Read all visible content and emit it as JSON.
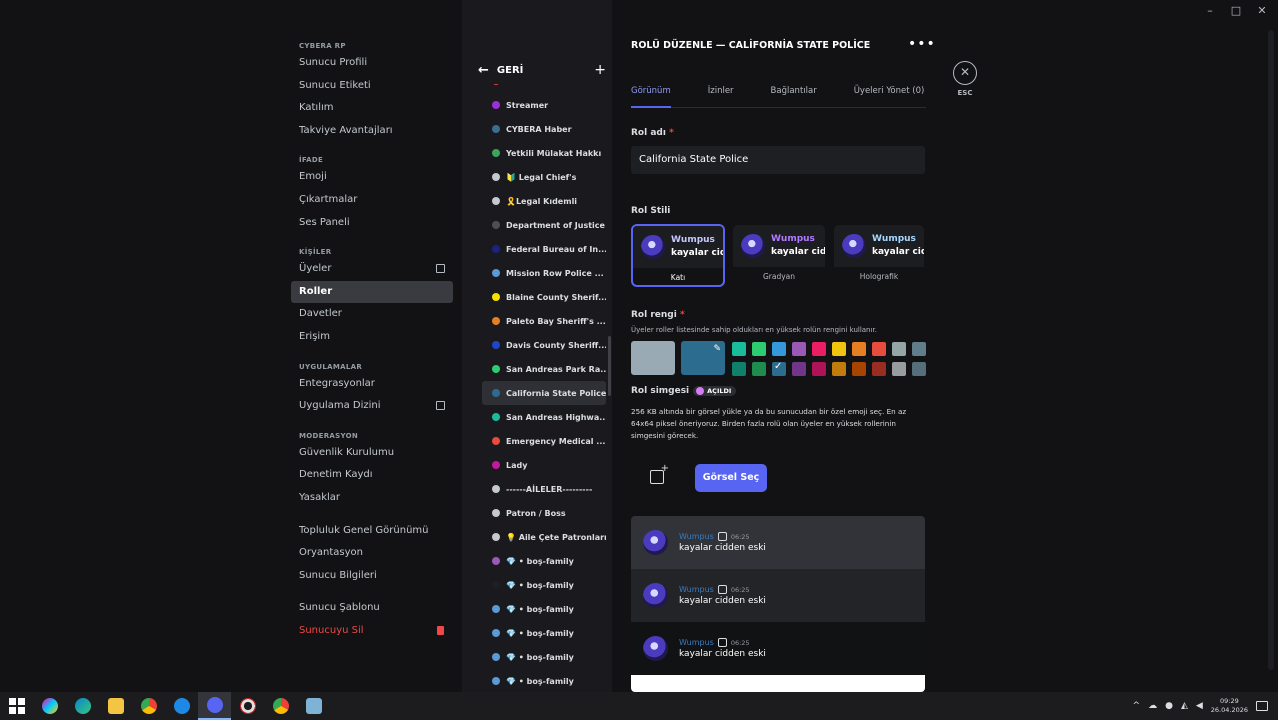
{
  "window": {
    "minimize": "–",
    "maximize": "□",
    "close": "✕"
  },
  "leftnav": {
    "sections": [
      {
        "title": "CYBERA RP",
        "items": [
          "Sunucu Profili",
          "Sunucu Etiketi",
          "Katılım",
          "Takviye Avantajları"
        ]
      },
      {
        "title": "İFADE",
        "items": [
          "Emoji",
          "Çıkartmalar",
          "Ses Paneli"
        ]
      },
      {
        "title": "KİŞİLER",
        "items": [
          "Üyeler",
          "Roller",
          "Davetler",
          "Erişim"
        ]
      },
      {
        "title": "UYGULAMALAR",
        "items": [
          "Entegrasyonlar",
          "Uygulama Dizini"
        ]
      },
      {
        "title": "MODERASYON",
        "items": [
          "Güvenlik Kurulumu",
          "Denetim Kaydı",
          "Yasaklar"
        ]
      }
    ],
    "extra_items": [
      "Topluluk Genel Görünümü",
      "Oryantasyon",
      "Sunucu Bilgileri"
    ],
    "template_item": "Sunucu Şablonu",
    "delete_item": "Sunucuyu Sil",
    "active_item": "Roller"
  },
  "roles_panel": {
    "back_label": "GERİ",
    "add_symbol": "+",
    "partial_role": "♡ Koramal Stali",
    "roles": [
      {
        "name": "Streamer",
        "color": "#9b30d9"
      },
      {
        "name": "CYBERA Haber",
        "color": "#3b6e8f"
      },
      {
        "name": "Yetkili Mülakat Hakkı",
        "color": "#3ba55c"
      },
      {
        "name": "🔰 Legal Chief's",
        "color": "#c4c9ce"
      },
      {
        "name": "🎗️Legal Kıdemli",
        "color": "#c4c9ce"
      },
      {
        "name": "Department of Justice",
        "color": "#4e4e55"
      },
      {
        "name": "Federal Bureau of In...",
        "color": "#1a237e"
      },
      {
        "name": "Mission Row Police ...",
        "color": "#5b9bd5"
      },
      {
        "name": "Blaine County Sherif...",
        "color": "#f5e000"
      },
      {
        "name": "Paleto Bay Sheriff's ...",
        "color": "#e67e22"
      },
      {
        "name": "Davis County Sheriff...",
        "color": "#1f45c9"
      },
      {
        "name": "San Andreas Park Ra...",
        "color": "#2ecc71"
      },
      {
        "name": "California State Police",
        "color": "#2c6d8f"
      },
      {
        "name": "San Andreas Highwa...",
        "color": "#1abc9c"
      },
      {
        "name": "Emergency Medical ...",
        "color": "#e74c3c"
      },
      {
        "name": "Lady",
        "color": "#c2189e"
      },
      {
        "name": "------AİLELER---------",
        "color": "#c4c9ce"
      },
      {
        "name": "Patron / Boss",
        "color": "#c4c9ce"
      },
      {
        "name": "💡 Aile Çete Patronları",
        "color": "#c4c9ce"
      },
      {
        "name": "💎 • boş-family",
        "color": "#9b59b6"
      },
      {
        "name": "💎 • boş-family",
        "color": "#1e1f22"
      },
      {
        "name": "💎 • boş-family",
        "color": "#5b9bd5"
      },
      {
        "name": "💎 • boş-family",
        "color": "#5b9bd5"
      },
      {
        "name": "💎 • boş-family",
        "color": "#5b9bd5"
      },
      {
        "name": "💎 • boş-family",
        "color": "#5b9bd5"
      }
    ],
    "active_role": "California State Police"
  },
  "editor": {
    "title": "ROLÜ DÜZENLE — CALİFORNİA STATE POLİCE",
    "more": "•••",
    "tabs": [
      "Görünüm",
      "İzinler",
      "Bağlantılar",
      "Üyeleri Yönet (0)"
    ],
    "active_tab": "Görünüm",
    "role_name_label": "Rol adı",
    "required_mark": "*",
    "role_name_value": "California  State Police",
    "style_label": "Rol Stili",
    "styles": [
      {
        "caption": "Katı",
        "line1": "Wumpus",
        "line2": "kayalar cidd"
      },
      {
        "caption": "Gradyan",
        "line1": "Wumpus",
        "line2": "kayalar cidc"
      },
      {
        "caption": "Holografik",
        "line1": "Wumpus",
        "line2": "kayalar cidc"
      }
    ],
    "selected_style": "Katı",
    "color_label": "Rol rengi",
    "color_hint": "Üyeler roller listesinde sahip oldukları en yüksek rolün rengini kullanır.",
    "default_color": "#99aab5",
    "custom_color": "#2c6d8f",
    "pencil": "✎",
    "swatches_top": [
      "#1abc9c",
      "#2ecc71",
      "#3498db",
      "#9b59b6",
      "#e91e63",
      "#f1c40f",
      "#e67e22",
      "#e74c3c",
      "#95a5a6",
      "#607d8b"
    ],
    "swatches_bottom": [
      "#11806a",
      "#1f8b4c",
      "#206694",
      "#71368a",
      "#ad1457",
      "#c27c0e",
      "#a84300",
      "#992d22",
      "#979c9f",
      "#546e7a"
    ],
    "selected_check": "✓",
    "icon_label": "Rol simgesi",
    "unlocked_badge": "AÇILDI",
    "icon_desc": "256 KB altında bir görsel yükle ya da bu sunucudan bir özel emoji seç. En az 64x64 piksel öneriyoruz. Birden fazla rolü olan üyeler en yüksek rollerinin simgesini görecek.",
    "choose_image_button": "Görsel Seç",
    "preview_username": "Wumpus",
    "preview_time": "06:25",
    "preview_message": "kayalar cidden eski"
  },
  "esc": {
    "symbol": "✕",
    "label": "ESC"
  },
  "taskbar": {
    "apps": [
      "start-icon",
      "copilot-icon",
      "edge-icon",
      "file-explorer-icon",
      "chrome-icon",
      "vpn-icon",
      "discord-icon",
      "opera-icon",
      "chrome-alt-icon",
      "notepad-icon"
    ],
    "tray_caret": "^",
    "time": "09:29",
    "date": "26.04.2026"
  }
}
